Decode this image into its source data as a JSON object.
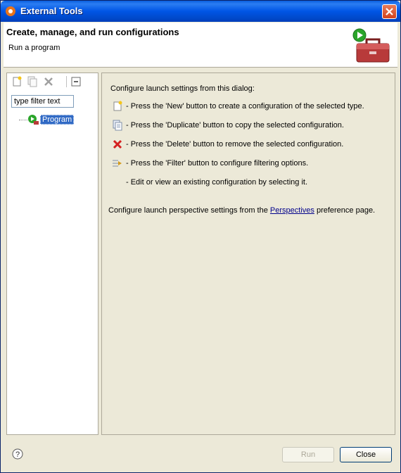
{
  "window": {
    "title": "External Tools"
  },
  "banner": {
    "heading": "Create, manage, and run configurations",
    "subtitle": "Run a program"
  },
  "toolbar": {
    "buttons": [
      "new-config-icon",
      "duplicate-config-icon",
      "delete-config-icon",
      "collapse-all-icon"
    ]
  },
  "filter": {
    "placeholder": "type filter text"
  },
  "tree": {
    "items": [
      {
        "label": "Program"
      }
    ]
  },
  "info": {
    "intro": "Configure launch settings from this dialog:",
    "hints": [
      {
        "icon": "new-icon",
        "text": "- Press the 'New' button to create a configuration of the selected type."
      },
      {
        "icon": "duplicate-icon",
        "text": "- Press the 'Duplicate' button to copy the selected configuration."
      },
      {
        "icon": "delete-icon",
        "text": "- Press the 'Delete' button to remove the selected configuration."
      },
      {
        "icon": "filter-icon",
        "text": "- Press the 'Filter' button to configure filtering options."
      },
      {
        "icon": "",
        "text": "- Edit or view an existing configuration by selecting it."
      }
    ],
    "perspectives_prefix": "Configure launch perspective settings from the ",
    "perspectives_link": "Perspectives",
    "perspectives_suffix": " preference page."
  },
  "buttons": {
    "run": "Run",
    "close": "Close"
  }
}
